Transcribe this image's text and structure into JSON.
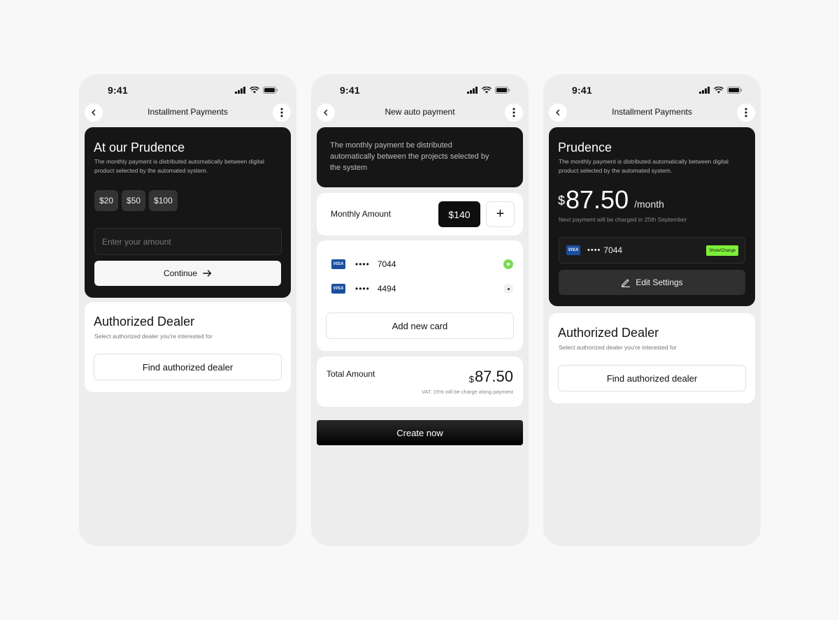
{
  "status": {
    "time": "9:41"
  },
  "screen1": {
    "nav_title": "Installment Payments",
    "hero": {
      "title": "At our Prudence",
      "description": "The monthly payment is distributed automatically between digital product selected by the automated system.",
      "chips": [
        "$20",
        "$50",
        "$100"
      ],
      "input_placeholder": "Enter your amount",
      "continue_label": "Continue"
    },
    "dealer": {
      "title": "Authorized Dealer",
      "description": "Select authorized dealer you're interested for",
      "button_label": "Find authorized dealer"
    }
  },
  "screen2": {
    "nav_title": "New auto payment",
    "description": "The monthly payment be distributed automatically between the projects selected by the system",
    "monthly": {
      "label": "Monthly Amount",
      "value": "$140",
      "plus": "+"
    },
    "cards": [
      {
        "brand": "VISA",
        "dots": "••••",
        "last4": "7044",
        "selected": true
      },
      {
        "brand": "VISA",
        "dots": "••••",
        "last4": "4494",
        "selected": false
      }
    ],
    "add_card_label": "Add new card",
    "total": {
      "label": "Total Amount",
      "currency": "$",
      "amount": "87.50",
      "vat_note": "VAT. 15% will be charge along payment"
    },
    "create_label": "Create now"
  },
  "screen3": {
    "nav_title": "Installment Payments",
    "hero": {
      "title": "Prudence",
      "description": "The monthly payment is distributed automatically between digital product selected by the automated system.",
      "currency": "$",
      "amount": "87.50",
      "period": "/month",
      "next_payment": "Next payment will be charged in 25th September",
      "card": {
        "brand": "VISA",
        "dots": "••••",
        "last4": "7044",
        "action": "Show/Change"
      },
      "edit_label": "Edit Settings"
    },
    "dealer": {
      "title": "Authorized Dealer",
      "description": "Select authorized dealer you're interested for",
      "button_label": "Find authorized dealer"
    }
  },
  "colors": {
    "dark_card": "#161616",
    "accent_green": "#7ef03a",
    "selected_radio": "#7ed957",
    "visa_blue": "#1a4fa0"
  }
}
